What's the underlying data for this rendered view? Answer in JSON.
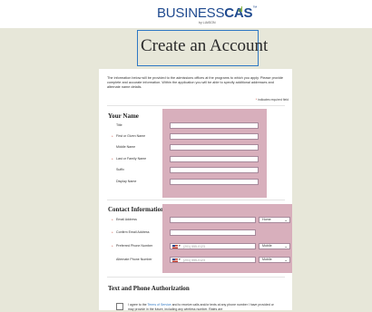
{
  "logo": {
    "brand_left": "BUSINESS",
    "brand_right": "CAS",
    "tm": "™",
    "sub": "by LIAISON"
  },
  "page_title": "Create an Account",
  "intro": "The information below will be provided to the admissions offices at the programs to which you apply. Please provide complete and accurate information. Within the application you will be able to specify additional addresses and alternate name details.",
  "required_note": {
    "star": "*",
    "text": "indicates required field"
  },
  "your_name": {
    "title": "Your Name",
    "fields": [
      {
        "label": "Title",
        "required": false
      },
      {
        "label": "First or Given Name",
        "required": true
      },
      {
        "label": "Middle Name",
        "required": false
      },
      {
        "label": "Last or Family Name",
        "required": true
      },
      {
        "label": "Suffix",
        "required": false
      },
      {
        "label": "Display Name",
        "required": false
      }
    ]
  },
  "contact": {
    "title": "Contact Information",
    "email_label": "Email Address",
    "email_type": "Home",
    "confirm_email_label": "Confirm Email Address",
    "phone_label": "Preferred Phone Number",
    "phone_placeholder": "(201) 555-0123",
    "phone_type": "Mobile",
    "alt_phone_label": "Alternate Phone Number",
    "alt_phone_placeholder": "(201) 555-0123",
    "alt_phone_type": "Mobile"
  },
  "auth": {
    "title": "Text and Phone Authorization",
    "text_pre": "I agree to the ",
    "terms_link": "Terms of Service",
    "text_post": " and to receive calls and/or texts at any phone number I have provided or may provide in the future, including any wireless number. Rates are"
  },
  "colors": {
    "brand": "#1f4a8f",
    "highlight": "#d8afbc",
    "accent": "#86b34a",
    "required": "#c0392b"
  }
}
